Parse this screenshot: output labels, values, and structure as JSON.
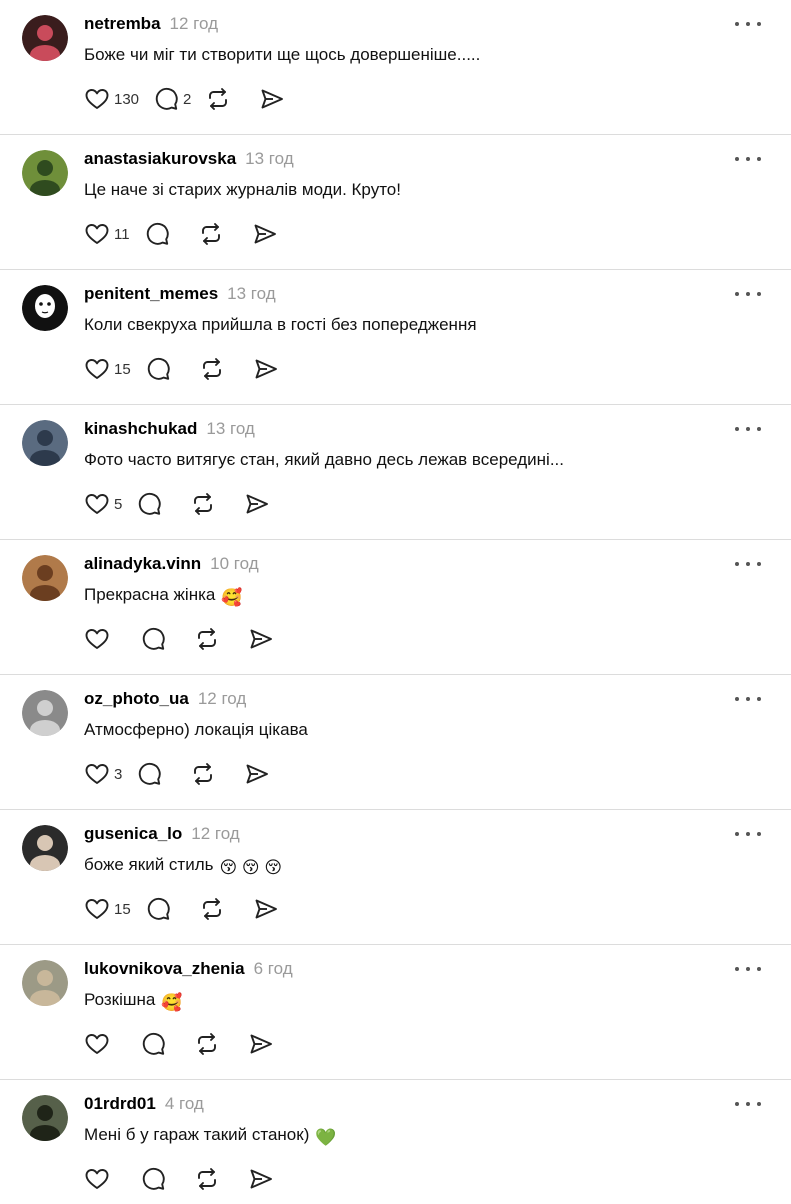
{
  "colors": {
    "text": "#111111",
    "muted": "#9a9a9a",
    "divider": "#dcdcdc",
    "icon": "#222222"
  },
  "icons": {
    "like": "heart-icon",
    "reply": "speech-bubble-icon",
    "repost": "repost-icon",
    "share": "send-icon",
    "more": "ellipsis-icon"
  },
  "posts": [
    {
      "username": "netremba",
      "time": "12 год",
      "text": "Боже чи міг ти створити ще щось довершеніше.....",
      "emoji": "",
      "likes": "130",
      "replies": "2"
    },
    {
      "username": "anastasiakurovska",
      "time": "13 год",
      "text": "Це наче зі старих журналів моди. Круто!",
      "emoji": "",
      "likes": "11",
      "replies": ""
    },
    {
      "username": "penitent_memes",
      "time": "13 год",
      "text": "Коли свекруха прийшла в гості без попередження",
      "emoji": "",
      "likes": "15",
      "replies": ""
    },
    {
      "username": "kinashchukad",
      "time": "13 год",
      "text": "Фото часто витягує стан, який давно десь лежав всередині...",
      "emoji": "",
      "likes": "5",
      "replies": ""
    },
    {
      "username": "alinadyka.vinn",
      "time": "10 год",
      "text": "Прекрасна жінка",
      "emoji": "🥰",
      "likes": "",
      "replies": ""
    },
    {
      "username": "oz_photo_ua",
      "time": "12 год",
      "text": "Атмосферно) локація цікава",
      "emoji": "",
      "likes": "3",
      "replies": ""
    },
    {
      "username": "gusenica_lo",
      "time": "12 год",
      "text": "боже який стиль",
      "emoji": "😚 😚 😚",
      "likes": "15",
      "replies": ""
    },
    {
      "username": "lukovnikova_zhenia",
      "time": "6 год",
      "text": "Розкішна",
      "emoji": "🥰",
      "likes": "",
      "replies": ""
    },
    {
      "username": "01rdrd01",
      "time": "4 год",
      "text": "Мені б у гараж такий станок)",
      "emoji": "💚",
      "likes": "",
      "replies": ""
    }
  ]
}
